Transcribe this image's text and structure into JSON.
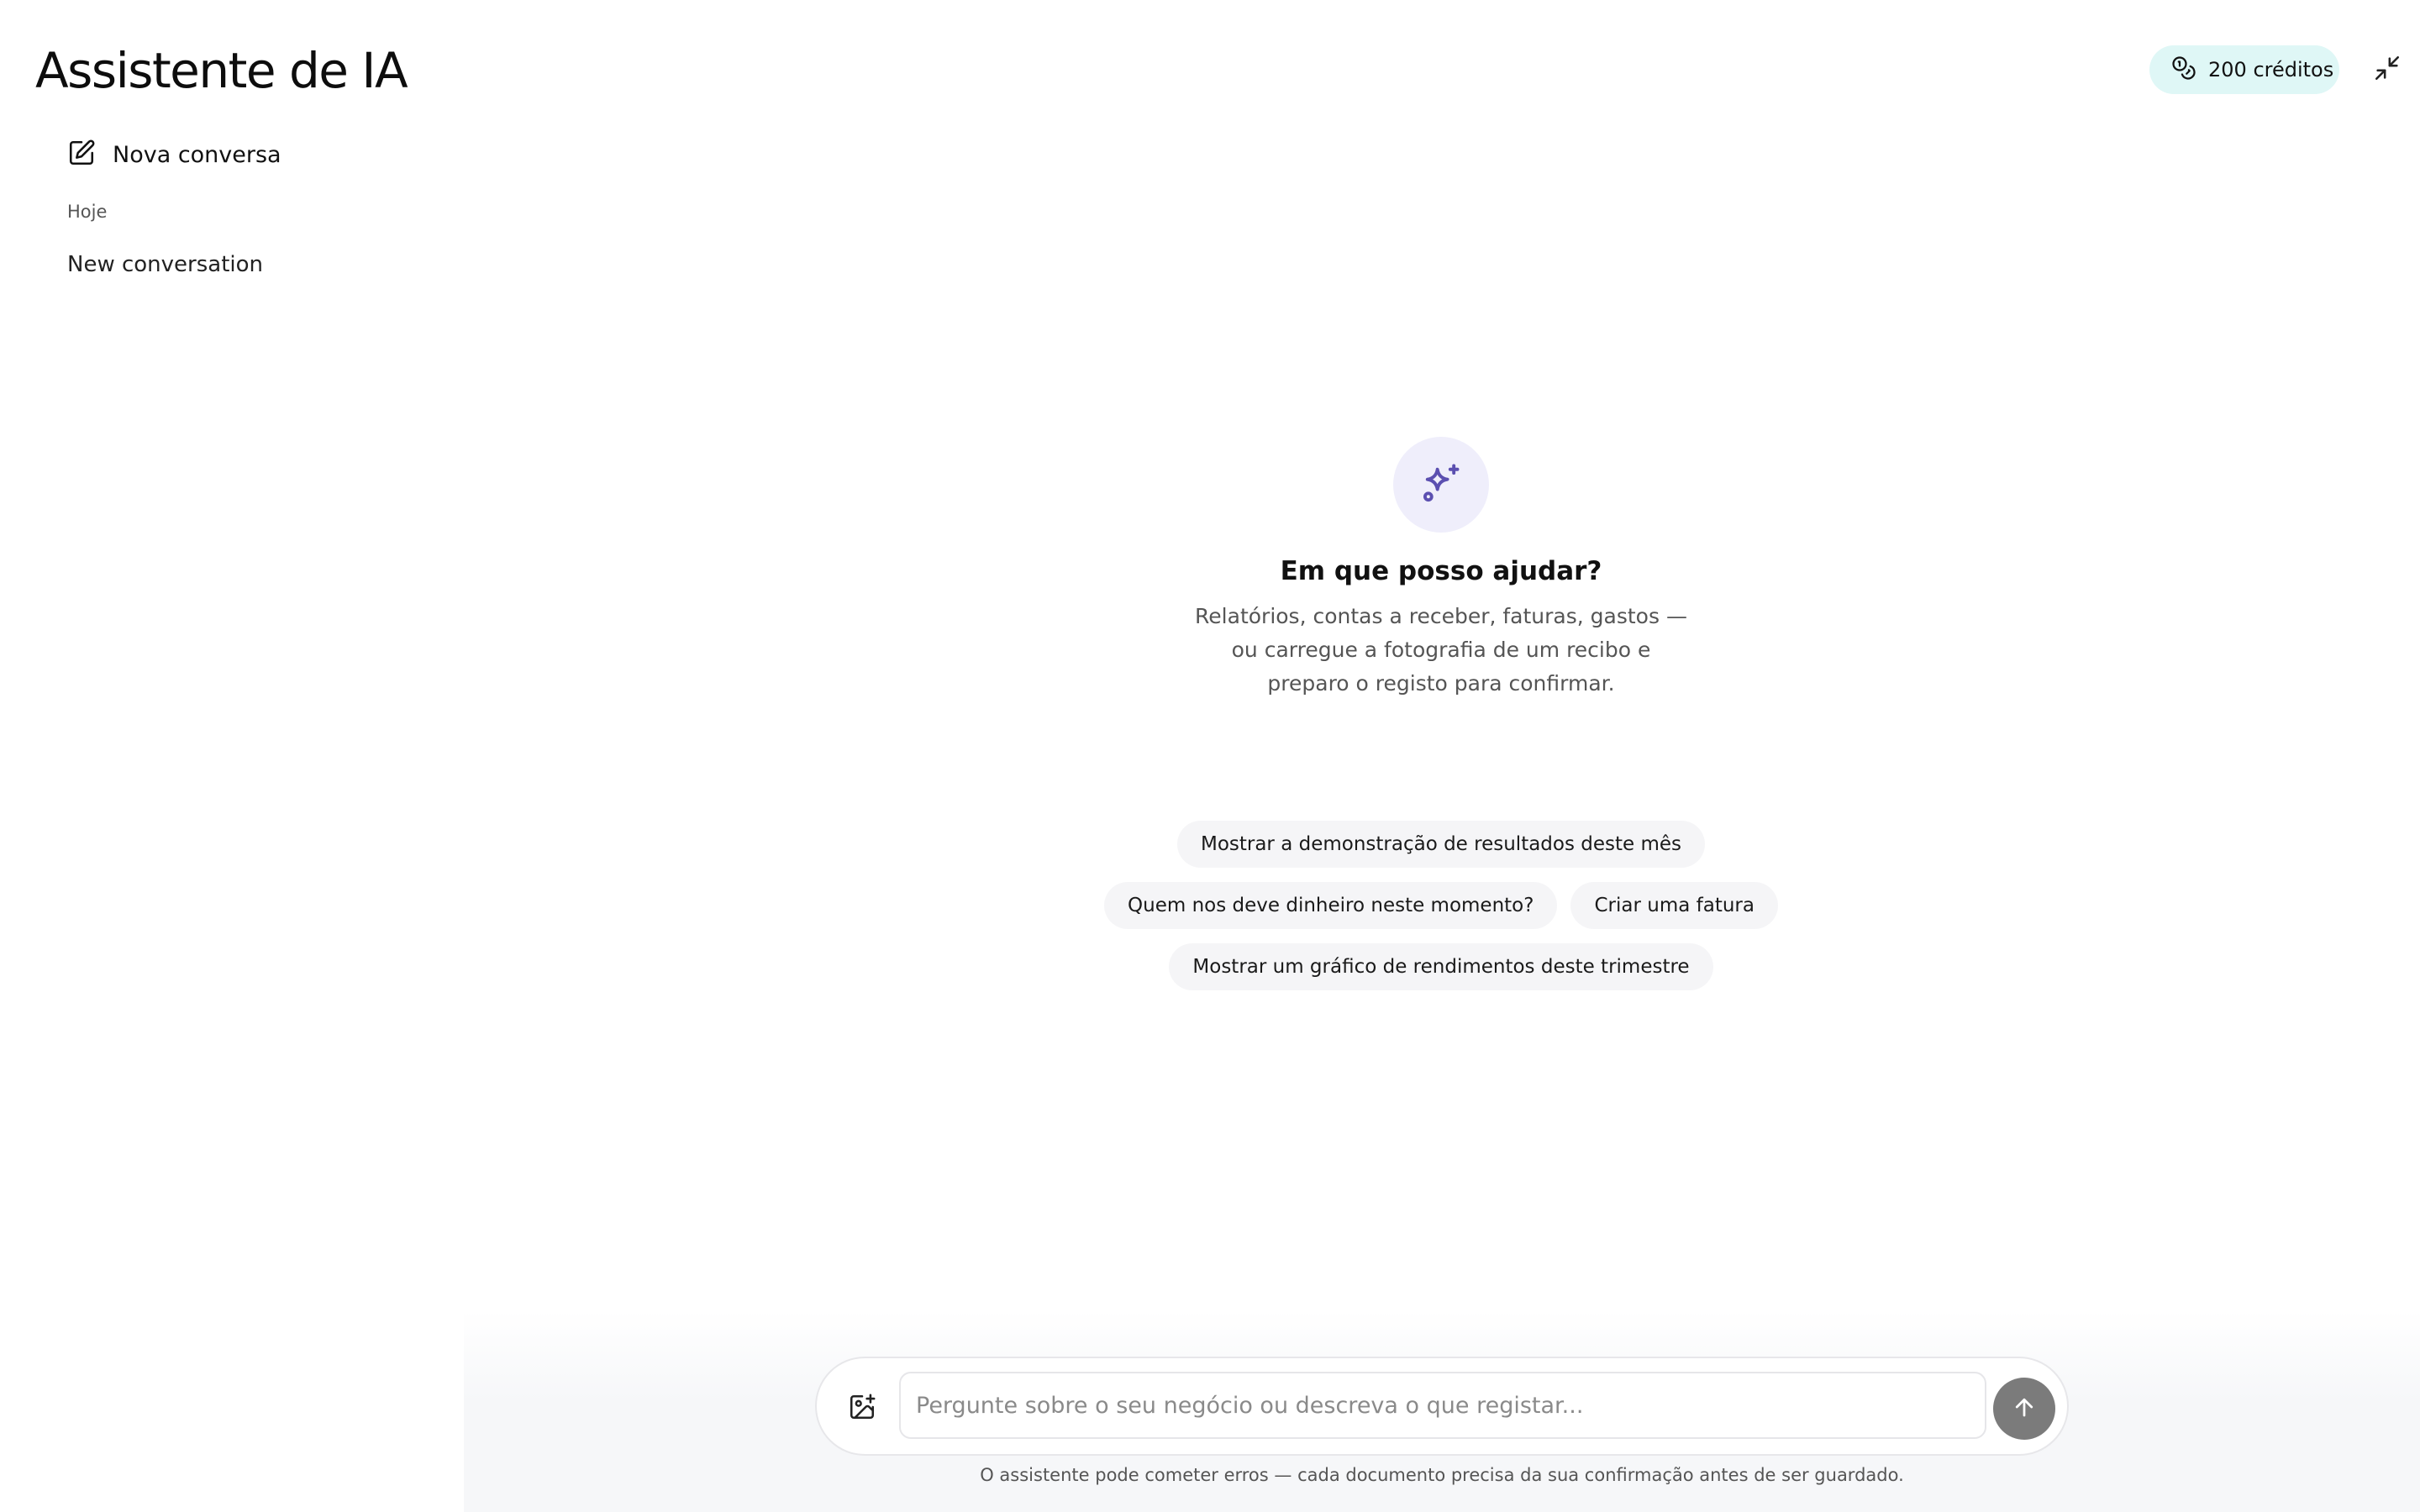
{
  "app": {
    "title": "Assistente de IA"
  },
  "header": {
    "credits_label": "200 créditos",
    "credits_icon": "coins-icon",
    "collapse_icon": "minimize-icon"
  },
  "sidebar": {
    "new_chat_label": "Nova conversa",
    "new_chat_icon": "edit-icon",
    "sections": [
      {
        "label": "Hoje",
        "items": [
          {
            "label": "New conversation"
          }
        ]
      }
    ]
  },
  "empty_state": {
    "icon": "sparkles-icon",
    "heading": "Em que posso ajudar?",
    "description": "Relatórios, contas a receber, faturas, gastos — ou carregue a fotografia de um recibo e preparo o registo para confirmar."
  },
  "suggestions": [
    {
      "label": "Mostrar a demonstração de resultados deste mês"
    },
    {
      "label": "Quem nos deve dinheiro neste momento?"
    },
    {
      "label": "Criar uma fatura"
    },
    {
      "label": "Mostrar um gráfico de rendimentos deste trimestre"
    }
  ],
  "composer": {
    "placeholder": "Pergunte sobre o seu negócio ou descreva o que registar...",
    "value": "",
    "attach_icon": "image-plus-icon",
    "send_icon": "arrow-up-icon",
    "disclaimer": "O assistente pode cometer erros — cada documento precisa da sua confirmação antes de ser guardado."
  },
  "colors": {
    "credits_bg": "#dff7f6",
    "sparkle_bg": "#efeefb",
    "sparkle_accent": "#5b4fb0",
    "chip_bg": "#f5f5f7",
    "send_bg": "#7b7b7b"
  }
}
